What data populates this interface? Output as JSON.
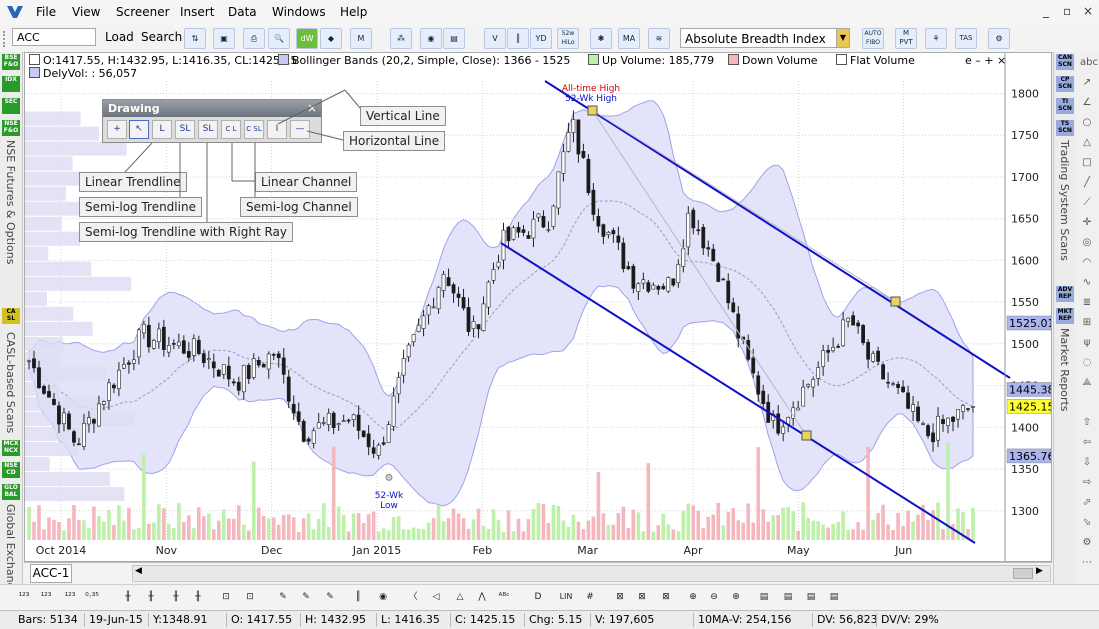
{
  "menu": {
    "items": [
      "File",
      "View",
      "Screener",
      "Insert",
      "Data",
      "Windows",
      "Help"
    ],
    "window_controls": [
      "_",
      "▫",
      "×"
    ]
  },
  "toolbar": {
    "symbol_value": "ACC",
    "load_label": "Load",
    "search_label": "Search",
    "indicator_value": "Absolute Breadth Index (ABI",
    "button_texts": {
      "dw": "dW",
      "mom": "M",
      "bars52": "52w HiLo",
      "ma": "MA",
      "autofibo": "AUTO FIBO",
      "mpvt": "M PVT",
      "tas": "TAS"
    }
  },
  "left_strip": {
    "badges": [
      {
        "text": "BSE F&O",
        "color": "#2a9a2a"
      },
      {
        "text": "IDX",
        "color": "#2a9a2a"
      },
      {
        "text": "SEC",
        "color": "#2a9a2a"
      },
      {
        "text": "NSE F&O",
        "color": "#2a9a2a"
      },
      {
        "text": "CA SL",
        "color": "#d4c020"
      },
      {
        "text": "MCX NCX",
        "color": "#2a9a2a"
      },
      {
        "text": "NSE CD",
        "color": "#2a9a2a"
      },
      {
        "text": "GLO BAL",
        "color": "#2a9a2a"
      }
    ],
    "section_labels": [
      "NSE Futures & Options",
      "CASL-based Scans",
      "Global Exchange"
    ]
  },
  "right_strip": {
    "badges": [
      "CAN SCN",
      "CP SCN",
      "TI SCN",
      "TS SCN",
      "ADV REP",
      "MKT REP"
    ],
    "section_labels": [
      "Trading System Scans",
      "Market Reports"
    ]
  },
  "chart_legend": {
    "ohlc": "O:1417.55, H:1432.95, L:1416.35, CL:1425.15",
    "dely_vol": "DelyVol: : 56,057",
    "bollinger": "Bollinger Bands (20,2, Simple, Close): 1366 - 1525",
    "up_volume": "Up Volume: 185,779",
    "down_volume": "Down Volume",
    "flat_volume": "Flat Volume",
    "window_ctrl": "e – + ×"
  },
  "drawing_panel": {
    "title": "Drawing",
    "close": "×",
    "buttons": [
      "+",
      "↖",
      "L",
      "SL",
      "SL",
      "C L",
      "C SL",
      "I",
      "—"
    ]
  },
  "callouts": {
    "vertical_line": "Vertical Line",
    "horizontal_line": "Horizontal Line",
    "linear_trendline": "Linear Trendline",
    "semilog_trendline": "Semi-log Trendline",
    "semilog_trendline_right_ray": "Semi-log Trendline with Right Ray",
    "linear_channel": "Linear Channel",
    "semilog_channel": "Semi-log Channel"
  },
  "chart_annotations": {
    "all_time_high": "All-time High",
    "wk52_high": "52-Wk High",
    "wk52_low_line1": "52-Wk",
    "wk52_low_line2": "Low"
  },
  "chart_data": {
    "type": "candlestick",
    "symbol": "ACC",
    "x_tick_labels": [
      "Oct 2014",
      "Nov",
      "Dec",
      "Jan 2015",
      "Feb",
      "Mar",
      "Apr",
      "May",
      "Jun"
    ],
    "y_tick_labels": [
      "1800",
      "1750",
      "1700",
      "1650",
      "1600",
      "1550",
      "1500",
      "1450",
      "1400",
      "1350",
      "1300"
    ],
    "ylim": [
      1265,
      1815
    ],
    "price_tags": [
      {
        "value": 1525.01,
        "label": "1525.01",
        "color": "#aab4ee"
      },
      {
        "value": 1445.38,
        "label": "1445.38",
        "color": "#aab4ee"
      },
      {
        "value": 1425.15,
        "label": "1425.15",
        "color": "#ffff33"
      },
      {
        "value": 1365.76,
        "label": "1365.76",
        "color": "#aab4ee"
      }
    ],
    "all_time_high": 1775,
    "low_52wk": 1340,
    "last_close": 1425.15,
    "close_anchors": [
      {
        "t": 0,
        "v": 1480
      },
      {
        "t": 0.05,
        "v": 1380
      },
      {
        "t": 0.08,
        "v": 1440
      },
      {
        "t": 0.12,
        "v": 1510
      },
      {
        "t": 0.18,
        "v": 1490
      },
      {
        "t": 0.22,
        "v": 1455
      },
      {
        "t": 0.26,
        "v": 1490
      },
      {
        "t": 0.29,
        "v": 1395
      },
      {
        "t": 0.34,
        "v": 1410
      },
      {
        "t": 0.37,
        "v": 1370
      },
      {
        "t": 0.4,
        "v": 1480
      },
      {
        "t": 0.44,
        "v": 1590
      },
      {
        "t": 0.47,
        "v": 1510
      },
      {
        "t": 0.5,
        "v": 1620
      },
      {
        "t": 0.55,
        "v": 1650
      },
      {
        "t": 0.575,
        "v": 1765
      },
      {
        "t": 0.6,
        "v": 1660
      },
      {
        "t": 0.64,
        "v": 1580
      },
      {
        "t": 0.68,
        "v": 1570
      },
      {
        "t": 0.7,
        "v": 1660
      },
      {
        "t": 0.73,
        "v": 1590
      },
      {
        "t": 0.76,
        "v": 1480
      },
      {
        "t": 0.79,
        "v": 1400
      },
      {
        "t": 0.83,
        "v": 1460
      },
      {
        "t": 0.87,
        "v": 1530
      },
      {
        "t": 0.89,
        "v": 1480
      },
      {
        "t": 0.92,
        "v": 1440
      },
      {
        "t": 0.95,
        "v": 1390
      },
      {
        "t": 1.0,
        "v": 1425
      }
    ]
  },
  "tabbar": {
    "tab_label": "ACC-1"
  },
  "statusbar": {
    "bars": "Bars: 5134",
    "date": "19-Jun-15",
    "y": "Y:1348.91",
    "open": "O: 1417.55",
    "high": "H: 1432.95",
    "low": "L: 1416.35",
    "close": "C: 1425.15",
    "chg": "Chg: 5.15",
    "vol": "V: 197,605",
    "ma_vol": "10MA-V: 254,156",
    "dv": "DV: 56,823",
    "dvv": "DV/V: 29%"
  },
  "bottom_toolbar": {
    "lin_label": "LIN"
  }
}
